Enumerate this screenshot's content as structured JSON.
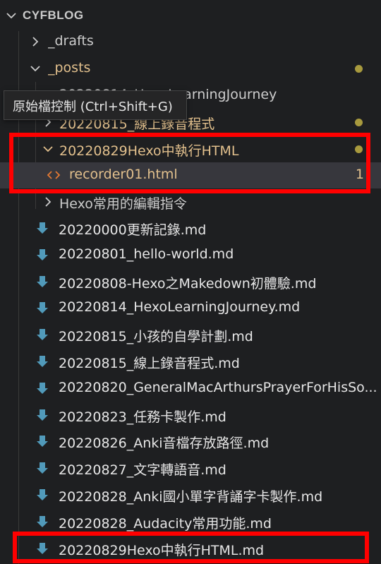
{
  "explorer": {
    "root_label": "CYFBLOG",
    "tooltip": "原始檔控制 (Ctrl+Shift+G)",
    "rows": {
      "drafts": "_drafts",
      "posts": "_posts",
      "learning_journey": "20220814_HexoLearningJourney",
      "recorder_folder": "20220815_線上錄音程式",
      "hexo_html_folder": "20220829Hexo中執行HTML",
      "recorder_file": "recorder01.html",
      "recorder_badge": "1",
      "hexo_cmds": "Hexo常用的編輯指令",
      "md_files": [
        "20220000更新記錄.md",
        "20220801_hello-world.md",
        "20220808-Hexo之Makedown初體驗.md",
        "20220814_HexoLearningJourney.md",
        "20220815_小孩的自學計劃.md",
        "20220815_線上錄音程式.md",
        "20220820_GeneralMacArthursPrayerForHisSo...",
        "20220823_任務卡製作.md",
        "20220826_Anki音檔存放路徑.md",
        "20220827_文字轉語音.md",
        "20220828_Anki國小單字背誦字卡製作.md",
        "20220828_Audacity常用功能.md",
        "20220829Hexo中執行HTML.md"
      ]
    }
  },
  "colors": {
    "background": "#1e1f21",
    "modified_text": "#e2c08d",
    "modified_dot": "#a89a3e",
    "md_icon": "#519aba",
    "html_icon": "#e37933",
    "highlight_box": "#ff0000"
  }
}
